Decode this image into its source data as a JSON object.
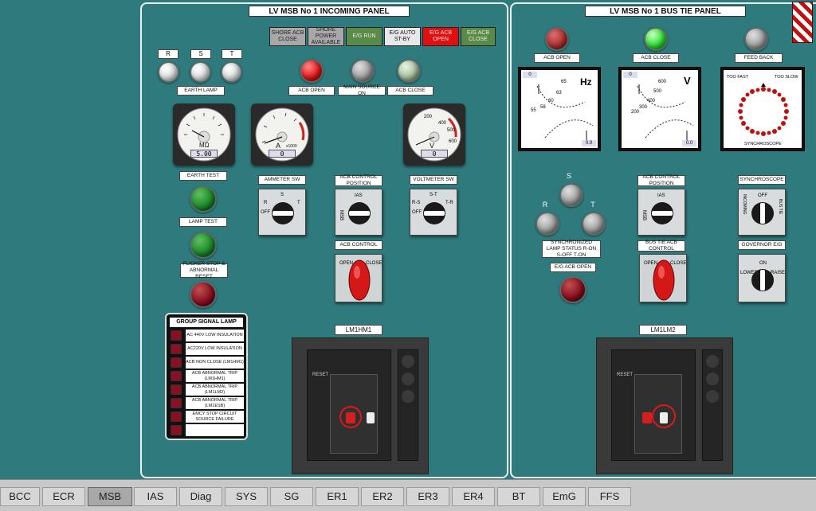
{
  "incoming": {
    "title": "LV MSB No 1 INCOMING PANEL",
    "indicators": [
      {
        "label": "SHORE ACB CLOSE",
        "bg": "#a8a8a8",
        "fg": "#222"
      },
      {
        "label": "SHORE POWER AVAILABLE",
        "bg": "#a8a8a8",
        "fg": "#222"
      },
      {
        "label": "E/G RUN",
        "bg": "#5a8a48",
        "fg": "#e8f0e0"
      },
      {
        "label": "E/G AUTO ST-BY",
        "bg": "#e8e8e8",
        "fg": "#111"
      },
      {
        "label": "E/G ACB OPEN",
        "bg": "#e01010",
        "fg": "#ffdada"
      },
      {
        "label": "E/G ACB CLOSE",
        "bg": "#5a8a48",
        "fg": "#e8f0e0"
      }
    ],
    "rst": [
      "R",
      "S",
      "T"
    ],
    "earth_lamp": "EARTH LAMP",
    "acb_open": "ACB OPEN",
    "main_source_on": "MAIN SOURCE ON",
    "acb_close": "ACB CLOSE",
    "earth_test": "EARTH TEST",
    "lamp_test": "LAMP TEST",
    "flicker_stop": "FLICKER STOP & ABNORMAL RESET",
    "ammeter_sw": "AMMETER SW",
    "acb_control_position": "ACB CONTROL POSITION",
    "voltmeter_sw": "VOLTMETER SW",
    "acb_control": "ACB CONTROL",
    "breaker_label": "LM1HM1",
    "megohm_readout": "5.00",
    "megohm_unit": "MΩ",
    "amp_readout": "0",
    "amp_unit": "A",
    "amp_mult": "x1000",
    "volt_readout": "0",
    "volt_unit": "V",
    "volt_scale": [
      "200",
      "400",
      "500",
      "600"
    ],
    "amm_sw_pos": {
      "r": "R",
      "s": "S",
      "t": "T",
      "off": "OFF"
    },
    "ctrl_pos": {
      "ias": "IAS",
      "msb": "MSB"
    },
    "volt_sw_pos": {
      "st": "S-T",
      "rs": "R-S",
      "tr": "T-R",
      "off": "OFF"
    },
    "open": "OPEN",
    "close": "CLOSE",
    "reset": "RESET"
  },
  "group_signal": {
    "title": "GROUP SIGNAL LAMP",
    "items": [
      "AC 440V LOW INSULATION",
      "AC220V LOW INSULATION",
      "ACB NON CLOSE (LM1HM1)",
      "ACB ABNORMAL TRIP (LM1HM1)",
      "ACB ABNORMAL TRIP (LM1LM2)",
      "ACB ABNORMAL TRIP (LM1ESB)",
      "EMCY STOP CIRCUIT SOURCE FAILURE",
      ""
    ]
  },
  "bustie": {
    "title": "LV MSB No 1 BUS TIE PANEL",
    "acb_open": "ACB OPEN",
    "acb_close": "ACB CLOSE",
    "feed_back": "FEED BACK",
    "hz_unit": "Hz",
    "hz_scale": [
      "55",
      "58",
      "60",
      "63",
      "65"
    ],
    "hz_readout_top": "0",
    "hz_readout_bottom": "0.0",
    "v_unit": "V",
    "v_scale": [
      "200",
      "300",
      "400",
      "500",
      "600"
    ],
    "v_readout_top": "0",
    "v_readout_bottom": "0.0",
    "too_fast": "TOO FAST",
    "too_slow": "TOO SLOW",
    "synchroscope": "SYNCHROSCOPE",
    "rst": [
      "S",
      "R",
      "T"
    ],
    "sync_lamp_status": "SYNCHRONIZED LAMP STATUS R-ON S-OFF T-ON",
    "eg_acb_open": "E/G ACB OPEN",
    "acb_control_position": "ACB CONTROL POSITION",
    "bus_tie_acb_control": "BUS TIE ACB CONTROL",
    "synchroscope_sw": "SYNCHROSCOPE",
    "sync_sw_pos": {
      "off": "OFF",
      "incoming": "INCOMING",
      "bus_tie": "BUS TIE"
    },
    "governor": "GOVERNOR E/G",
    "gov_pos": {
      "on": "ON",
      "lower": "LOWER",
      "raise": "RAISE"
    },
    "breaker_label": "LM1LM2",
    "ctrl_pos": {
      "ias": "IAS",
      "msb": "MSB"
    },
    "open": "OPEN",
    "close": "CLOSE",
    "reset": "RESET"
  },
  "tabs": [
    "BCC",
    "ECR",
    "MSB",
    "IAS",
    "Diag",
    "SYS",
    "SG",
    "ER1",
    "ER2",
    "ER3",
    "ER4",
    "BT",
    "EmG",
    "FFS"
  ],
  "active_tab": "MSB"
}
